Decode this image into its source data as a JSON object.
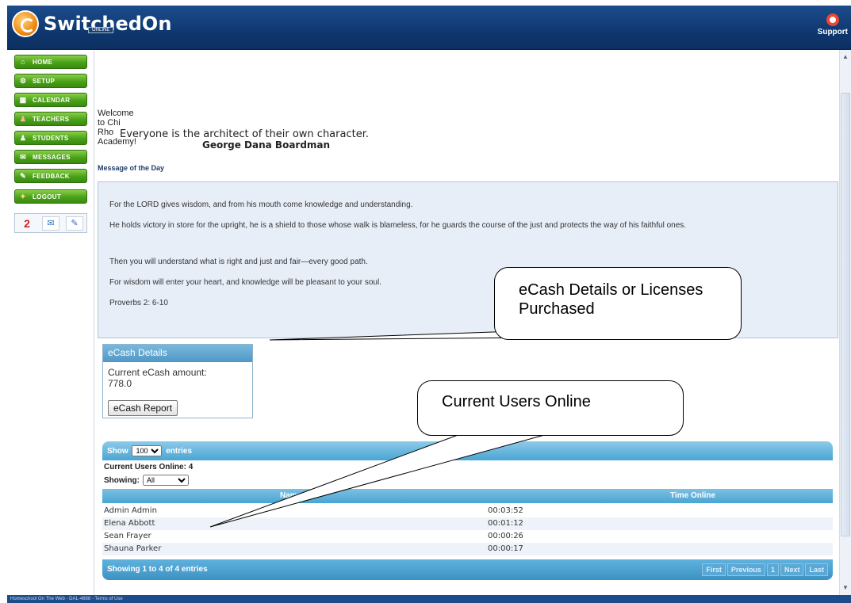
{
  "header": {
    "logo_text": "SwitchedOn",
    "logo_sub": "ONLINE",
    "support_label": "Support"
  },
  "sidebar": {
    "items": [
      {
        "label": "HOME",
        "icon": "home-icon"
      },
      {
        "label": "SETUP",
        "icon": "gear-icon"
      },
      {
        "label": "CALENDAR",
        "icon": "calendar-icon"
      },
      {
        "label": "TEACHERS",
        "icon": "teacher-icon"
      },
      {
        "label": "STUDENTS",
        "icon": "student-icon"
      },
      {
        "label": "MESSAGES",
        "icon": "envelope-icon"
      },
      {
        "label": "FEEDBACK",
        "icon": "chat-icon"
      },
      {
        "label": "LOGOUT",
        "icon": "key-icon"
      }
    ],
    "mini": {
      "count": "2"
    }
  },
  "main": {
    "welcome": "Welcome to Chi Rho Academy!",
    "quote": "Everyone is the architect of their own character.",
    "quote_author": "George Dana Boardman",
    "motd_title": "Message of the Day",
    "motd_lines": [
      "For the LORD gives wisdom, and from his mouth come knowledge and understanding.",
      "He holds victory in store for the upright, he is a shield to those whose walk is blameless, for he guards the course of the just and protects the way of his faithful ones.",
      "Then you will understand what is right and just and fair—every good path.",
      "For wisdom will enter your heart, and knowledge will be pleasant to your soul.",
      "Proverbs 2: 6-10"
    ]
  },
  "callouts": {
    "ecash": "eCash Details or Licenses Purchased",
    "users": "Current Users Online"
  },
  "ecash": {
    "title": "eCash Details",
    "label": "Current eCash amount:",
    "amount": "778.0",
    "report_button": "eCash Report"
  },
  "users_table": {
    "show_label": "Show",
    "show_value": "100",
    "entries_label": "entries",
    "current_users": "Current Users Online: 4",
    "showing_label": "Showing:",
    "showing_value": "All",
    "columns": [
      "Name",
      "Time Online"
    ],
    "rows": [
      [
        "Admin Admin",
        "00:03:52"
      ],
      [
        "Elena Abbott",
        "00:01:12"
      ],
      [
        "Sean Frayer",
        "00:00:26"
      ],
      [
        "Shauna Parker",
        "00:00:17"
      ]
    ],
    "footer_info": "Showing 1 to 4 of 4 entries",
    "pager": [
      "First",
      "Previous",
      "1",
      "Next",
      "Last"
    ]
  },
  "footer": {
    "text": "Homeschool On The Web - DAL-4888 - Terms of Use"
  }
}
